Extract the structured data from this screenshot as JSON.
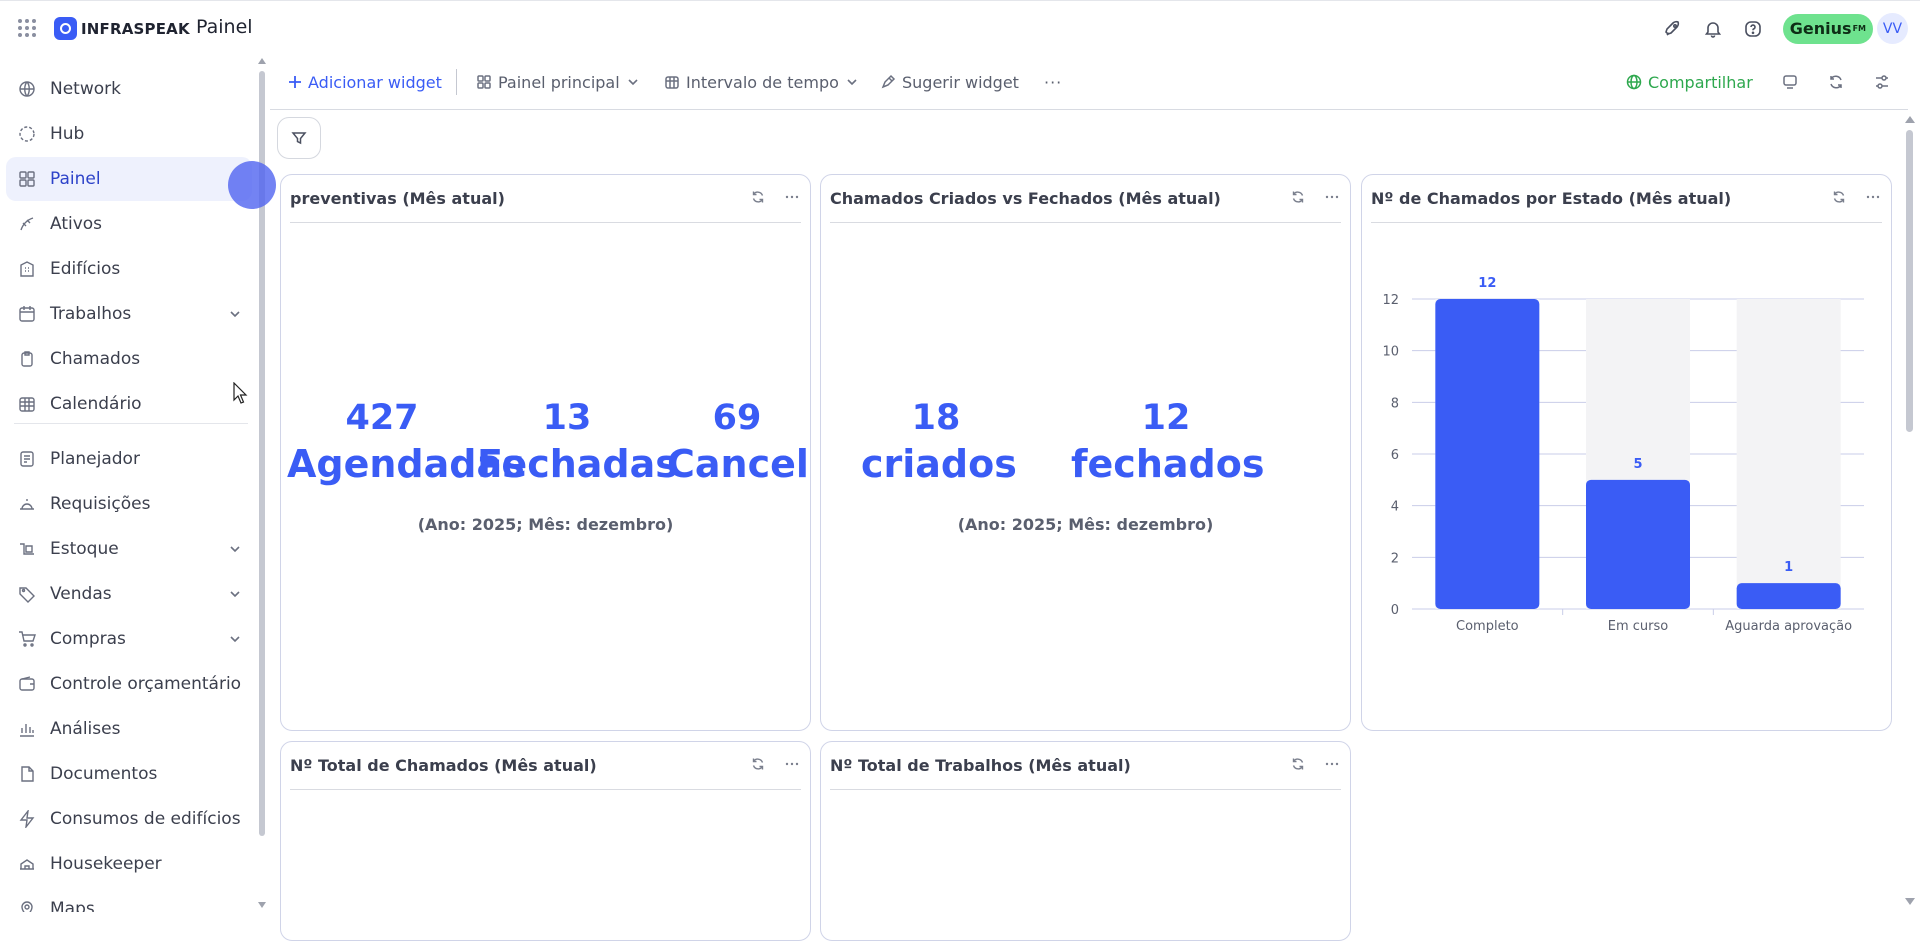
{
  "topbar": {
    "brand": "INFRASPEAK",
    "page_title": "Painel",
    "genius_label": "Genius",
    "genius_suffix": "FM",
    "avatar_initials": "VV",
    "icons": [
      "apps-grid-icon",
      "rocket-icon",
      "bell-icon",
      "help-icon"
    ]
  },
  "sidebar": {
    "items": [
      {
        "label": "Network",
        "icon": "network-icon"
      },
      {
        "label": "Hub",
        "icon": "hub-icon"
      },
      {
        "label": "Painel",
        "icon": "dashboard-icon",
        "active": true
      },
      {
        "label": "Ativos",
        "icon": "assets-icon"
      },
      {
        "label": "Edifícios",
        "icon": "building-icon"
      },
      {
        "label": "Trabalhos",
        "icon": "calendar-icon",
        "expandable": true
      },
      {
        "label": "Chamados",
        "icon": "clipboard-icon"
      },
      {
        "label": "Calendário",
        "icon": "calendar-grid-icon"
      },
      {
        "label": "Planejador",
        "icon": "planner-icon"
      },
      {
        "label": "Requisições",
        "icon": "bell-service-icon"
      },
      {
        "label": "Estoque",
        "icon": "stock-icon",
        "expandable": true
      },
      {
        "label": "Vendas",
        "icon": "tag-icon",
        "expandable": true
      },
      {
        "label": "Compras",
        "icon": "cart-icon",
        "expandable": true
      },
      {
        "label": "Controle orçamentário",
        "icon": "wallet-icon"
      },
      {
        "label": "Análises",
        "icon": "bar-chart-icon"
      },
      {
        "label": "Documentos",
        "icon": "document-icon"
      },
      {
        "label": "Consumos de edifícios",
        "icon": "lightning-icon"
      },
      {
        "label": "Housekeeper",
        "icon": "housekeeper-icon"
      },
      {
        "label": "Maps",
        "icon": "map-pin-icon"
      }
    ]
  },
  "toolbar": {
    "add_widget": "Adicionar widget",
    "dashboard_select": "Painel principal",
    "time_interval": "Intervalo de tempo",
    "suggest_widget": "Sugerir widget",
    "more": "···",
    "share": "Compartilhar"
  },
  "widgets": {
    "preventivas": {
      "title": "preventivas (Mês atual)",
      "kpis": [
        {
          "value": "427",
          "label": "Agendadas"
        },
        {
          "value": "13",
          "label": "Fechadas"
        },
        {
          "value": "69",
          "label": "Cancelad"
        }
      ],
      "caption": "(Ano: 2025; Mês: dezembro)"
    },
    "chamados_cv": {
      "title": "Chamados Criados vs Fechados (Mês atual)",
      "kpis": [
        {
          "value": "18",
          "label": "criados"
        },
        {
          "value": "12",
          "label": "fechados"
        }
      ],
      "caption": "(Ano: 2025; Mês: dezembro)"
    },
    "chamados_estado": {
      "title": "Nº de Chamados por Estado (Mês atual)"
    },
    "total_chamados": {
      "title": "Nº Total de Chamados (Mês atual)"
    },
    "total_trabalhos": {
      "title": "Nº Total de Trabalhos (Mês atual)"
    }
  },
  "chart_data": {
    "type": "bar",
    "categories": [
      "Completo",
      "Em curso",
      "Aguarda aprovação"
    ],
    "values": [
      12,
      5,
      1
    ],
    "ylim": [
      0,
      12
    ],
    "yticks": [
      0,
      2,
      4,
      6,
      8,
      10,
      12
    ],
    "bar_color": "#3a5cf5",
    "track_color": "#f3f3f5",
    "grid": true
  },
  "colors": {
    "accent": "#3a5cf5",
    "share_green": "#2ea84e",
    "genius_green": "#6ee28e"
  }
}
